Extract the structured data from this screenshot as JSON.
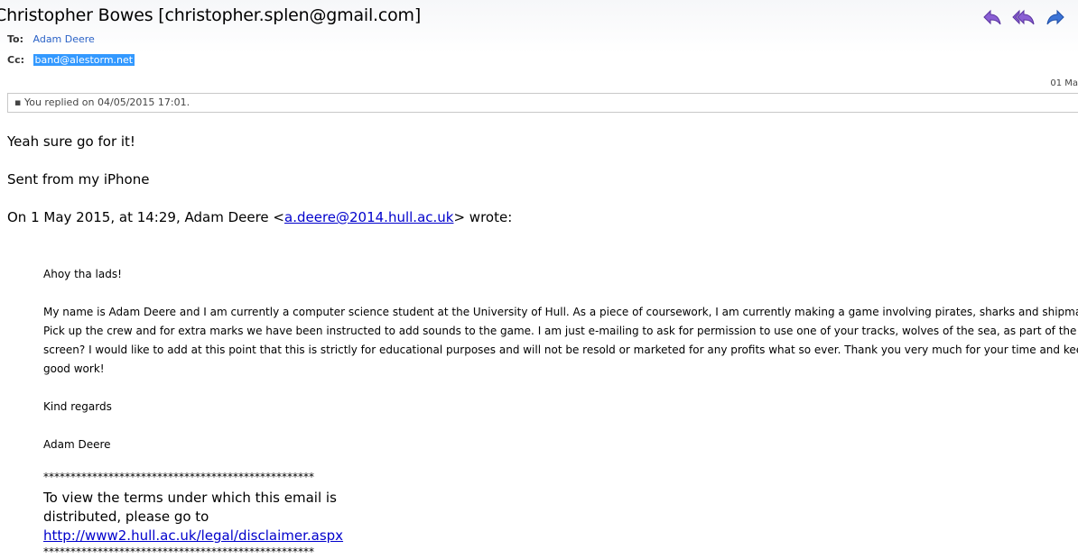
{
  "header": {
    "sender": "Christopher Bowes [christopher.splen@gmail.com]",
    "to_label": "To:",
    "to_value": "Adam Deere",
    "cc_label": "Cc:",
    "cc_value": "band@alestorm.net",
    "date": "01 Ma",
    "actions": {
      "reply": "reply-icon",
      "reply_all": "reply-all-icon",
      "forward": "forward-icon",
      "accent": "#7b4fc6"
    }
  },
  "replied_notice": "You replied on 04/05/2015 17:01.",
  "body": {
    "line1": "Yeah sure go for it!",
    "line2": "Sent from my iPhone",
    "wrote_prefix": "On 1 May 2015, at 14:29, Adam Deere <",
    "wrote_email": "a.deere@2014.hull.ac.uk",
    "wrote_suffix": "> wrote:"
  },
  "quoted": {
    "greeting": "Ahoy tha lads!",
    "para_lines": [
      "My name is Adam Deere and I am currently a computer science student at the University of Hull. As a piece of coursework, I am currently making a game involving pirates, sharks and shipmates calle",
      "Pick up the crew and for extra marks we have been instructed to add sounds to the game. I am just e-mailing to ask for permission to use one of your tracks, wolves of the sea, as part of the title",
      "screen? I would like to add at this point that this is strictly for educational purposes and will not be resold or marketed for any profits what so ever. Thank you very much for your time and keep up the",
      "good work!"
    ],
    "regards": "Kind regards",
    "name": "Adam Deere",
    "stars": "**************************************************",
    "disclaimer_line1": "To view the terms under which this email is",
    "disclaimer_line2": "distributed, please go to",
    "disclaimer_link": "http://www2.hull.ac.uk/legal/disclaimer.aspx",
    "stars2": "**************************************************"
  }
}
